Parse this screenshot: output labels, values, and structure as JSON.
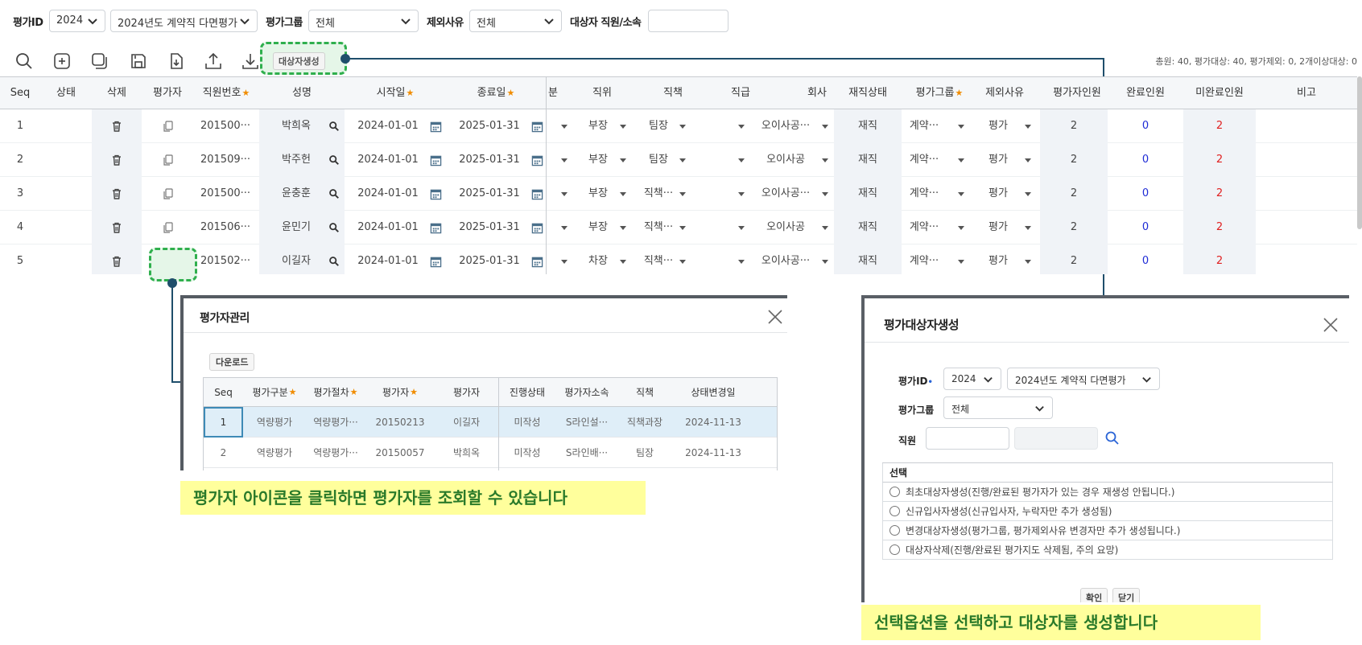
{
  "filters": {
    "eval_id_label": "평가ID",
    "year": "2024",
    "eval_name": "2024년도 계약직 다면평가",
    "group_label": "평가그룹",
    "group_value": "전체",
    "exclude_label": "제외사유",
    "exclude_value": "전체",
    "target_label": "대상자 직원/소속",
    "target_value": ""
  },
  "toolbar": {
    "generate_label": "대상자생성",
    "summary": "총원: 40, 평가대상: 40, 평가제외: 0, 2개이상대상: 0"
  },
  "grid": {
    "columns": [
      "Seq",
      "상태",
      "삭제",
      "평가자",
      "직원번호",
      "성명",
      "시작일",
      "종료일",
      "분",
      "직위",
      "직책",
      "직급",
      "회사",
      "재직상태",
      "평가그룹",
      "제외사유",
      "평가자인원",
      "완료인원",
      "미완료인원",
      "비고"
    ],
    "rows": [
      {
        "seq": "1",
        "emp_no": "201500···",
        "name": "박희옥",
        "start": "2024-01-01",
        "end": "2025-01-31",
        "position": "부장",
        "duty": "팀장",
        "company": "오이사공···",
        "status": "재직",
        "group": "계약···",
        "reason": "평가",
        "evaluators": "2",
        "done": "0",
        "undone": "2"
      },
      {
        "seq": "2",
        "emp_no": "201509···",
        "name": "박주헌",
        "start": "2024-01-01",
        "end": "2025-01-31",
        "position": "부장",
        "duty": "팀장",
        "company": "오이사공",
        "status": "재직",
        "group": "계약···",
        "reason": "평가",
        "evaluators": "2",
        "done": "0",
        "undone": "2"
      },
      {
        "seq": "3",
        "emp_no": "201500···",
        "name": "윤충훈",
        "start": "2024-01-01",
        "end": "2025-01-31",
        "position": "부장",
        "duty": "직책···",
        "company": "오이사공···",
        "status": "재직",
        "group": "계약···",
        "reason": "평가",
        "evaluators": "2",
        "done": "0",
        "undone": "2"
      },
      {
        "seq": "4",
        "emp_no": "201506···",
        "name": "윤민기",
        "start": "2024-01-01",
        "end": "2025-01-31",
        "position": "부장",
        "duty": "직책···",
        "company": "오이사공",
        "status": "재직",
        "group": "계약···",
        "reason": "평가",
        "evaluators": "2",
        "done": "0",
        "undone": "2"
      },
      {
        "seq": "5",
        "emp_no": "201502···",
        "name": "이길자",
        "start": "2024-01-01",
        "end": "2025-01-31",
        "position": "차장",
        "duty": "직책···",
        "company": "오이사공···",
        "status": "재직",
        "group": "계약···",
        "reason": "평가",
        "evaluators": "2",
        "done": "0",
        "undone": "2"
      }
    ]
  },
  "popup_evaluator": {
    "title": "평가자관리",
    "download_label": "다운로드",
    "columns": [
      "Seq",
      "평가구분",
      "평가절차",
      "평가자",
      "평가자",
      "진행상태",
      "평가자소속",
      "직책",
      "상태변경일"
    ],
    "rows": [
      {
        "seq": "1",
        "type": "역량평가",
        "step": "역량평가···",
        "evaluator_no": "20150213",
        "evaluator": "이길자",
        "progress": "미작성",
        "dept": "S라인설···",
        "duty": "직책과장",
        "changed": "2024-11-13"
      },
      {
        "seq": "2",
        "type": "역량평가",
        "step": "역량평가···",
        "evaluator_no": "20150057",
        "evaluator": "박희옥",
        "progress": "미작성",
        "dept": "S라인배···",
        "duty": "팀장",
        "changed": "2024-11-13"
      }
    ]
  },
  "callout_left": "평가자 아이콘을 클릭하면 평가자를 조회할 수 있습니다",
  "popup_generate": {
    "title": "평가대상자생성",
    "eval_id_label": "평가ID",
    "year": "2024",
    "eval_name": "2024년도 계약직 다면평가",
    "group_label": "평가그룹",
    "group_value": "전체",
    "employee_label": "직원",
    "options_header": "선택",
    "options": [
      "최초대상자생성(진행/완료된 평가자가 있는 경우 재생성 안됩니다.)",
      "신규입사자생성(신규입사자, 누락자만 추가 생성됨)",
      "변경대상자생성(평가그룹, 평가제외사유 변경자만 추가 생성됩니다.)",
      "대상자삭제(진행/완료된 평가지도 삭제됨, 주의 요망)"
    ],
    "confirm_label": "확인",
    "close_label": "닫기"
  },
  "callout_right": "선택옵션을 선택하고 대상자를 생성합니다",
  "colors": {
    "accent_green": "#2faf4d",
    "connector": "#1f4e6b",
    "done_blue": "#1e2bd6",
    "undone_red": "#e02020",
    "callout_bg": "#ffff9c"
  },
  "icons": [
    "search-icon",
    "add-icon",
    "copy-icon",
    "save-icon",
    "download-icon",
    "upload-icon",
    "trash-icon",
    "copy-doc-icon",
    "calendar-icon",
    "close-icon",
    "chevron-down-icon"
  ]
}
